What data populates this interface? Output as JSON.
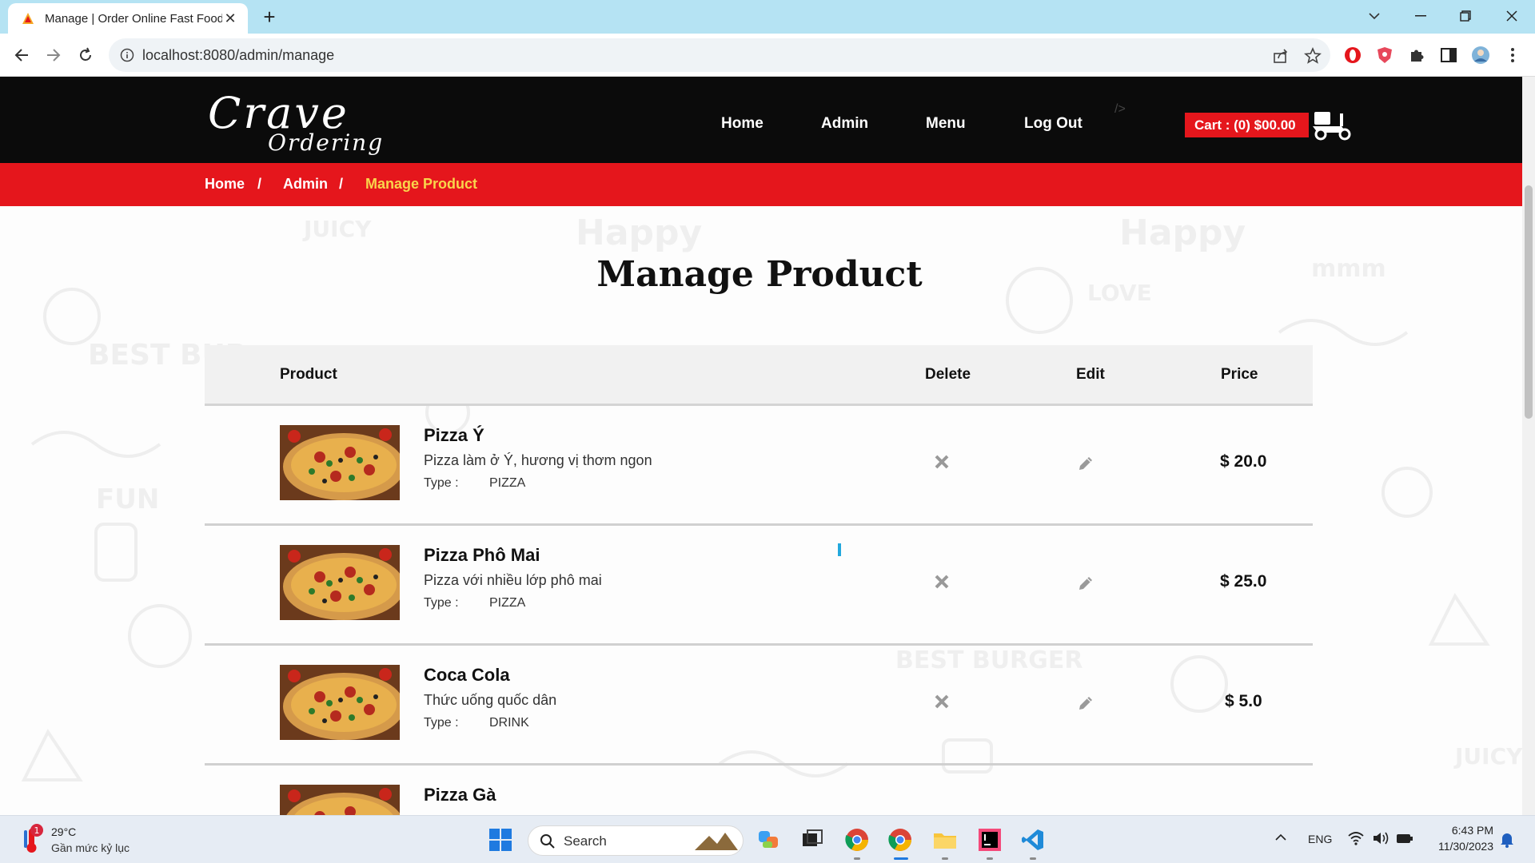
{
  "browser": {
    "tab_title": "Manage | Order Online Fast Food",
    "url": "localhost:8080/admin/manage"
  },
  "site": {
    "logo_line1": "Crave",
    "logo_line2": "Ordering",
    "nav": [
      "Home",
      "Admin",
      "Menu",
      "Log Out"
    ],
    "nav_slash": "/>",
    "cart": "Cart : (0) $00.00"
  },
  "breadcrumb": {
    "items": [
      "Home",
      "Admin",
      "Manage Product"
    ],
    "separator": "/"
  },
  "page_title": "Manage Product",
  "table": {
    "headers": {
      "product": "Product",
      "delete": "Delete",
      "edit": "Edit",
      "price": "Price"
    },
    "rows": [
      {
        "name": "Pizza Ý",
        "description": "Pizza làm ở Ý, hương vị thơm ngon",
        "type_label": "Type :",
        "type": "PIZZA",
        "price": "$ 20.0"
      },
      {
        "name": "Pizza Phô Mai",
        "description": "Pizza với nhiều lớp phô mai",
        "type_label": "Type :",
        "type": "PIZZA",
        "price": "$ 25.0"
      },
      {
        "name": "Coca Cola",
        "description": "Thức uống quốc dân",
        "type_label": "Type :",
        "type": "DRINK",
        "price": "$ 5.0"
      },
      {
        "name": "Pizza Gà",
        "description": "",
        "type_label": "",
        "type": "",
        "price": ""
      }
    ]
  },
  "taskbar": {
    "weather_temp": "29°C",
    "weather_desc": "Gần mức kỷ lục",
    "weather_badge": "1",
    "search_label": "Search",
    "language": "ENG",
    "time": "6:43 PM",
    "date": "11/30/2023"
  },
  "colors": {
    "brand_red": "#e5161c",
    "breadcrumb_active": "#f9d54b",
    "header_black": "#0b0b0b",
    "tabbar_blue": "#b5e3f3"
  }
}
